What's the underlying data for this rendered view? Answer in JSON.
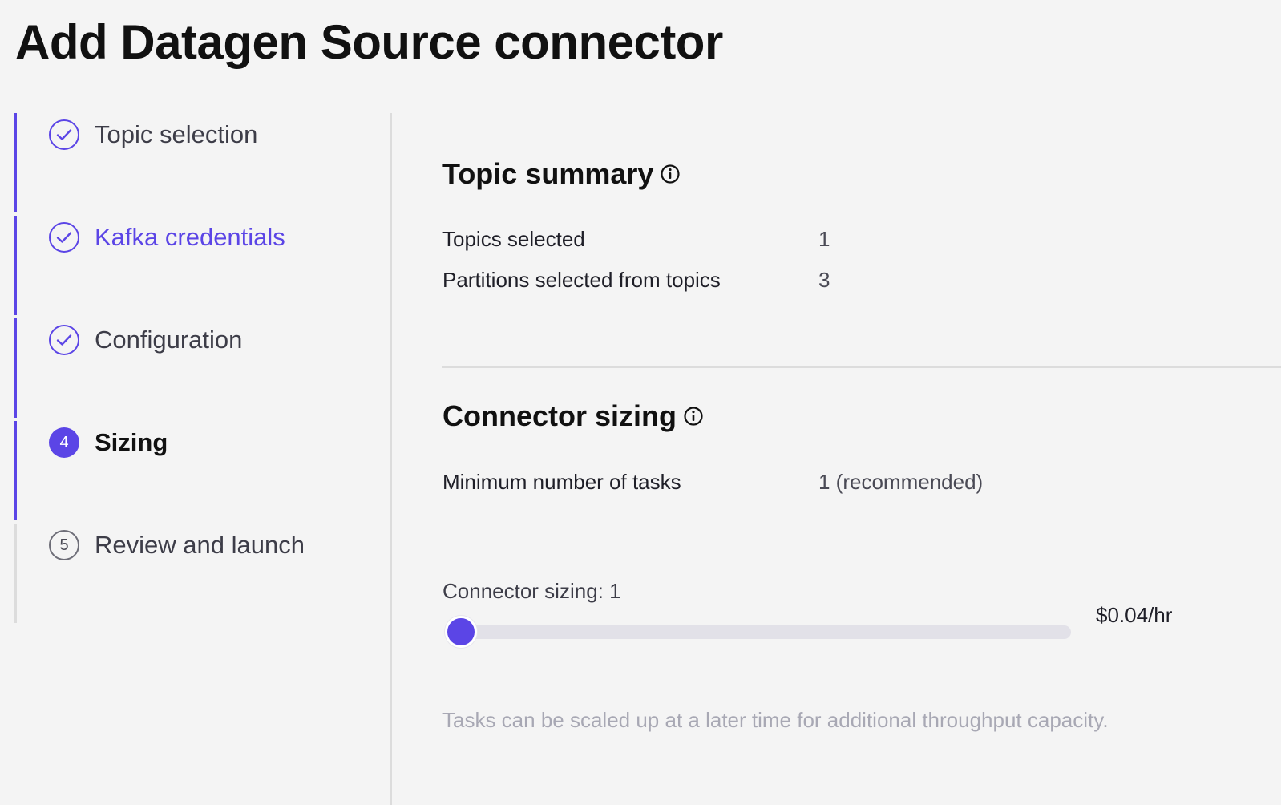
{
  "page": {
    "title": "Add Datagen Source connector"
  },
  "stepper": {
    "steps": [
      {
        "label": "Topic selection",
        "status": "completed",
        "icon": "check-circle-icon"
      },
      {
        "label": "Kafka credentials",
        "status": "completed",
        "icon": "check-circle-icon",
        "highlight": "link"
      },
      {
        "label": "Configuration",
        "status": "completed",
        "icon": "check-circle-icon"
      },
      {
        "label": "Sizing",
        "status": "current",
        "number": "4"
      },
      {
        "label": "Review and launch",
        "status": "pending",
        "number": "5"
      }
    ]
  },
  "topic_summary": {
    "title": "Topic summary",
    "info_icon": "info-icon",
    "rows": [
      {
        "label": "Topics selected",
        "value": "1"
      },
      {
        "label": "Partitions selected from topics",
        "value": "3"
      }
    ]
  },
  "connector_sizing": {
    "title": "Connector sizing",
    "info_icon": "info-icon",
    "min_tasks_label": "Minimum number of tasks",
    "min_tasks_value": "1 (recommended)",
    "slider_label": "Connector sizing: 1",
    "slider_fraction": 0,
    "price": "$0.04/hr",
    "helper": "Tasks can be scaled up at a later time for additional throughput capacity."
  },
  "colors": {
    "accent": "#5b45e6",
    "background": "#f4f4f4",
    "track": "#e2e1e8",
    "muted_text": "#a8a8b4"
  }
}
